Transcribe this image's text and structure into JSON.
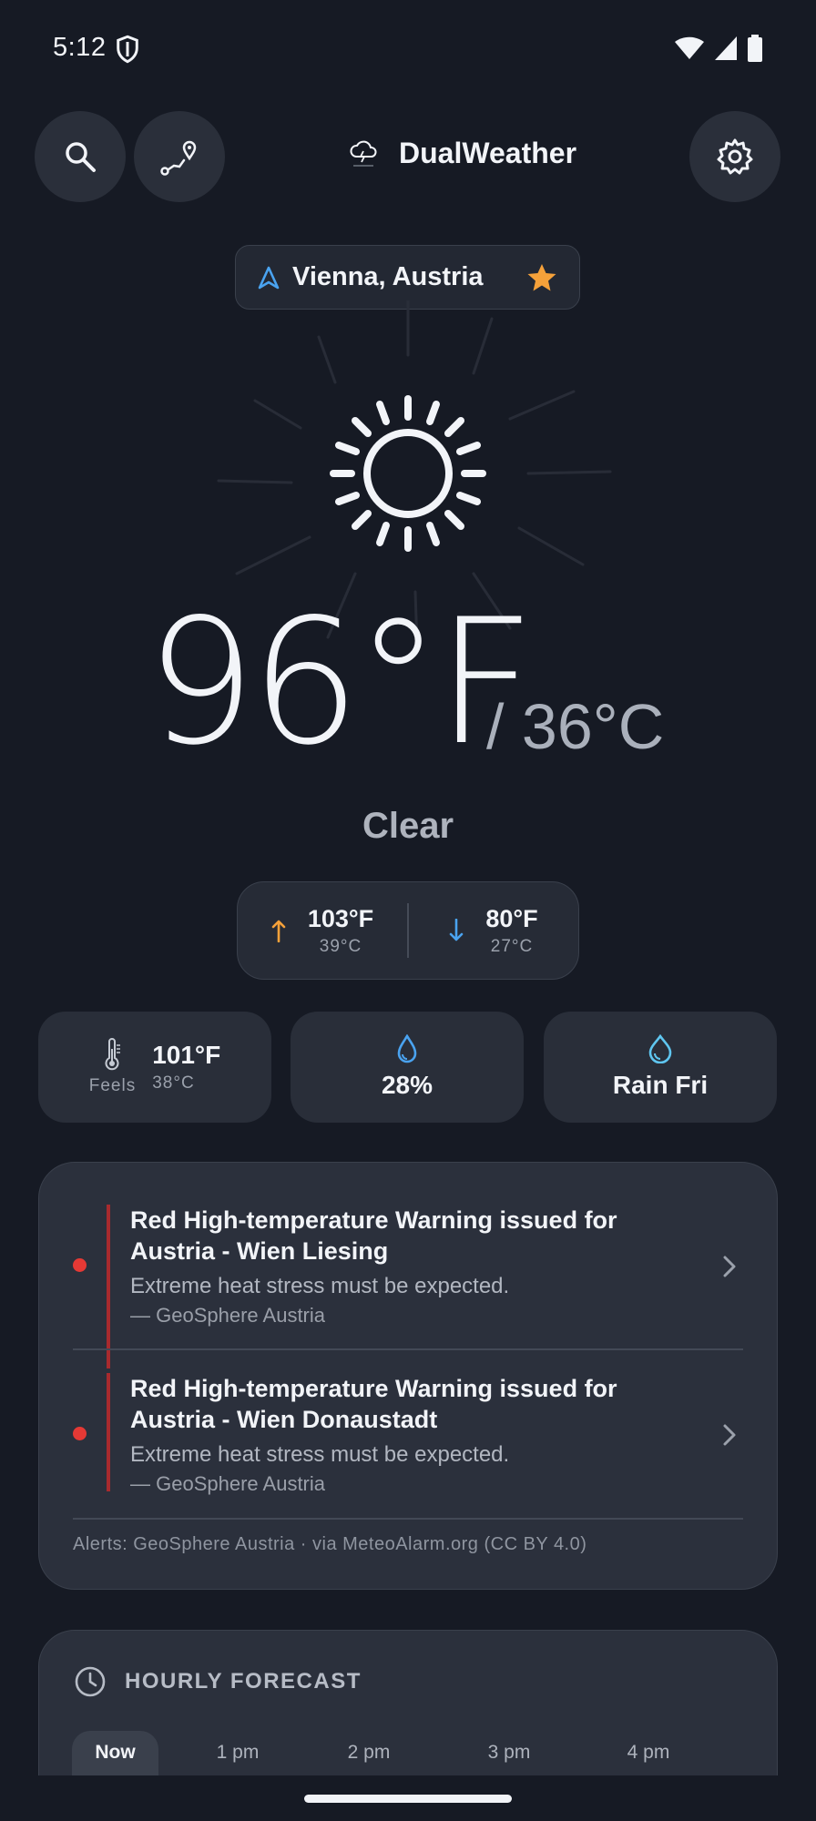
{
  "status_bar": {
    "time": "5:12"
  },
  "header": {
    "app_title": "DualWeather"
  },
  "location": {
    "name": "Vienna, Austria"
  },
  "current": {
    "temp_f": "96°F",
    "temp_c": "/ 36°C",
    "condition": "Clear"
  },
  "hilo": {
    "high_f": "103°F",
    "high_c": "39°C",
    "low_f": "80°F",
    "low_c": "27°C"
  },
  "stats": {
    "feels_label": "Feels",
    "feels_f": "101°F",
    "feels_c": "38°C",
    "humidity": "28%",
    "rain": "Rain Fri"
  },
  "alerts": {
    "items": [
      {
        "title": "Red High-temperature Warning issued for Austria - Wien Liesing",
        "description": "Extreme heat stress must be expected.",
        "source": "— GeoSphere Austria"
      },
      {
        "title": "Red High-temperature Warning issued for Austria - Wien Donaustadt",
        "description": "Extreme heat stress must be expected.",
        "source": "— GeoSphere Austria"
      }
    ],
    "footer": "Alerts: GeoSphere Austria · via MeteoAlarm.org (CC BY 4.0)"
  },
  "hourly": {
    "title": "HOURLY FORECAST",
    "hours": [
      "Now",
      "1 pm",
      "2 pm",
      "3 pm",
      "4 pm"
    ]
  },
  "colors": {
    "background": "#161a24",
    "card": "#2b303c",
    "high_arrow": "#f5a13a",
    "low_arrow": "#4aa3f0",
    "star": "#f5a13a",
    "alert_red": "#e53935",
    "location_arrow": "#4aa3f0"
  }
}
